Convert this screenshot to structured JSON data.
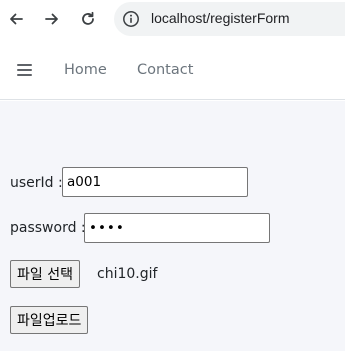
{
  "browser": {
    "url": "localhost/registerForm",
    "icons": [
      "back-arrow-icon",
      "forward-arrow-icon",
      "reload-icon",
      "site-info-icon"
    ]
  },
  "navbar": {
    "menu_icon": "hamburger-icon",
    "links": [
      {
        "label": "Home"
      },
      {
        "label": "Contact"
      }
    ]
  },
  "form": {
    "userid_label": "userId :",
    "userid_value": "a001",
    "password_label": "password :",
    "password_value": "••••",
    "file_button_label": "파일 선택",
    "file_name": "chi10.gif",
    "upload_button_label": "파일업로드"
  },
  "colors": {
    "content_background": "#f5f6fa",
    "nav_link": "#6c757d"
  }
}
